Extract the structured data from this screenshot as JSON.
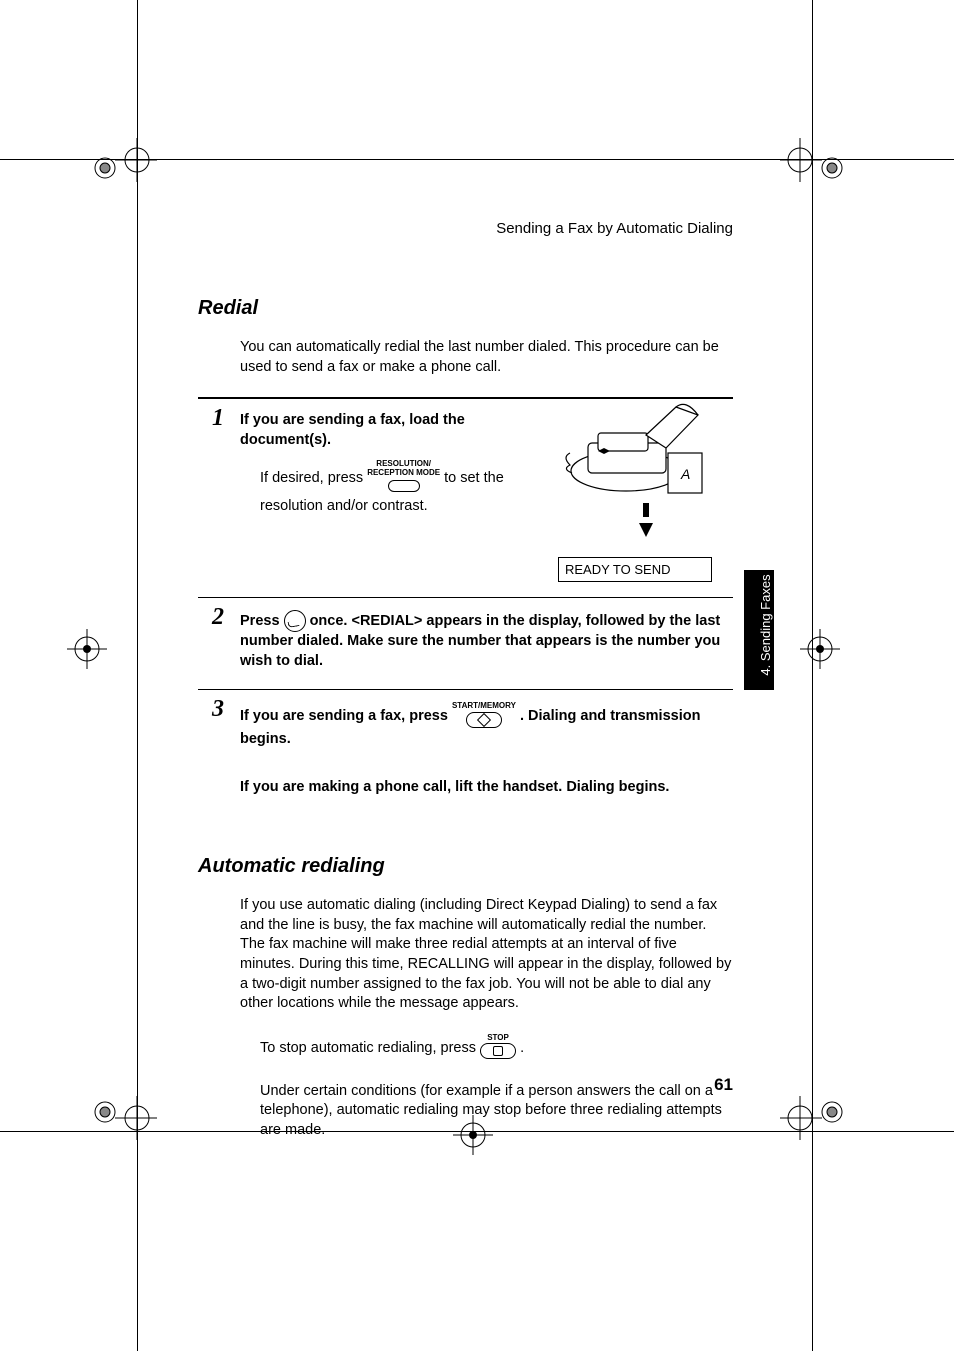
{
  "header": "Sending a Fax by Automatic Dialing",
  "redial": {
    "title": "Redial",
    "intro": "You can automatically redial the last number dialed. This procedure can be used to send a fax or make a phone call.",
    "step1": {
      "num": "1",
      "line1": "If you are sending a fax, load the document(s).",
      "line2a": "If desired, press ",
      "btn_label_top": "RESOLUTION/",
      "btn_label_bot": "RECEPTION MODE",
      "line2b": " to set the resolution and/or contrast.",
      "display": "READY TO SEND"
    },
    "step2": {
      "num": "2",
      "a": "Press ",
      "b": " once. <REDIAL> appears in the display, followed by the last number dialed. Make sure the number that appears is the number you wish to dial."
    },
    "step3": {
      "num": "3",
      "a": "If you are sending a fax, press ",
      "btn": "START/MEMORY",
      "b": ". Dialing and transmission begins.",
      "c": "If you are making a phone call, lift the handset. Dialing begins."
    }
  },
  "auto": {
    "title": "Automatic redialing",
    "p1": "If you use automatic dialing (including Direct Keypad Dialing) to send a fax and the line is busy, the fax machine will automatically redial the number. The fax machine will make three redial attempts at an interval of five minutes. During this time, RECALLING will appear in the display, followed by a two-digit number assigned to the fax job. You will not be able to dial any other locations while the message appears.",
    "p2a": "To stop automatic redialing, press ",
    "p2btn": "STOP",
    "p2b": ".",
    "p3": "Under certain conditions (for example if a person answers the call on a telephone), automatic redialing may stop before three redialing attempts are made."
  },
  "side_tab": "4. Sending Faxes",
  "pagenum": "61"
}
